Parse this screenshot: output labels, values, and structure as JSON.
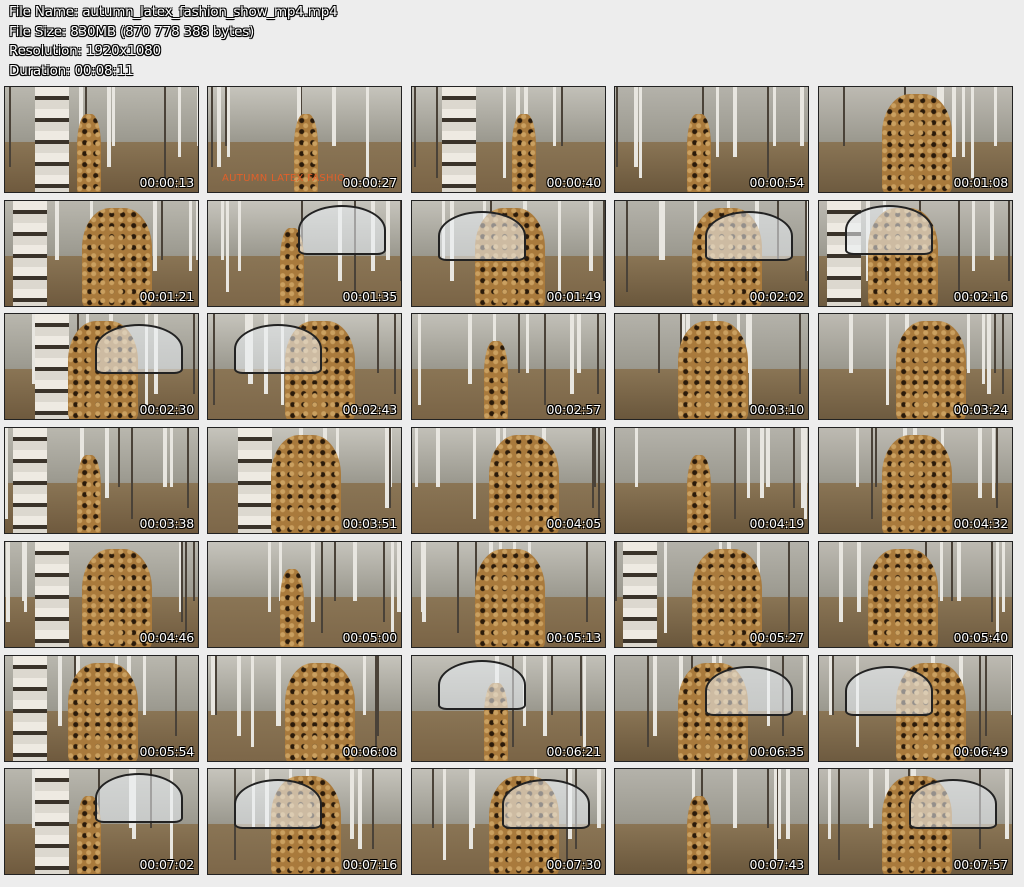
{
  "header": {
    "file_name": "File Name: autumn_latex_fashion_show_mp4.mp4",
    "file_size": "File Size: 830MB (870 778 388 bytes)",
    "resolution": "Resolution: 1920x1080",
    "duration": "Duration: 00:08:11"
  },
  "thumbnails": [
    {
      "time": "00:00:13"
    },
    {
      "time": "00:00:27",
      "overlay": "AUTUMN LATEX FASHIO"
    },
    {
      "time": "00:00:40"
    },
    {
      "time": "00:00:54"
    },
    {
      "time": "00:01:08"
    },
    {
      "time": "00:01:21"
    },
    {
      "time": "00:01:35"
    },
    {
      "time": "00:01:49"
    },
    {
      "time": "00:02:02"
    },
    {
      "time": "00:02:16"
    },
    {
      "time": "00:02:30"
    },
    {
      "time": "00:02:43"
    },
    {
      "time": "00:02:57"
    },
    {
      "time": "00:03:10"
    },
    {
      "time": "00:03:24"
    },
    {
      "time": "00:03:38"
    },
    {
      "time": "00:03:51"
    },
    {
      "time": "00:04:05"
    },
    {
      "time": "00:04:19"
    },
    {
      "time": "00:04:32"
    },
    {
      "time": "00:04:46"
    },
    {
      "time": "00:05:00"
    },
    {
      "time": "00:05:13"
    },
    {
      "time": "00:05:27"
    },
    {
      "time": "00:05:40"
    },
    {
      "time": "00:05:54"
    },
    {
      "time": "00:06:08"
    },
    {
      "time": "00:06:21"
    },
    {
      "time": "00:06:35"
    },
    {
      "time": "00:06:49"
    },
    {
      "time": "00:07:02"
    },
    {
      "time": "00:07:16"
    },
    {
      "time": "00:07:30"
    },
    {
      "time": "00:07:43"
    },
    {
      "time": "00:07:57"
    }
  ]
}
